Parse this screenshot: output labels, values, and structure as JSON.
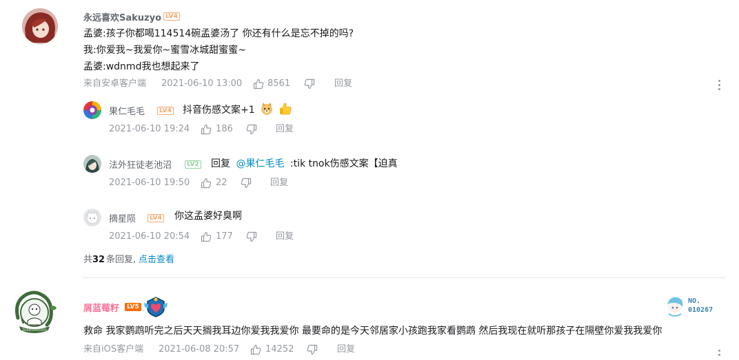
{
  "c1": {
    "username": "永远喜欢Sakuzyo",
    "level": "LV4",
    "lines": [
      "孟婆:孩子你都喝114514碗孟婆汤了 你还有什么是忘不掉的吗?",
      "我:你爱我~我爱你~蜜雪冰城甜蜜蜜~",
      "孟婆:wdnmd我也想起来了"
    ],
    "source": "来自安卓客户端",
    "time": "2021-06-10 13:00",
    "likes": "8561",
    "reply_label": "回复"
  },
  "replies": [
    {
      "username": "果仁毛毛",
      "level": "LV4",
      "text": "抖音伤感文案+1",
      "time": "2021-06-10 19:24",
      "likes": "186",
      "reply_label": "回复"
    },
    {
      "username": "法外狂徒老池沼",
      "level": "LV2",
      "prefix": "回复",
      "mention": "@果仁毛毛",
      "text": ":tik tnok伤感文案【迫真",
      "time": "2021-06-10 19:50",
      "likes": "22",
      "reply_label": "回复"
    },
    {
      "username": "摘星陨",
      "level": "LV4",
      "text": "你这孟婆好臭啊",
      "time": "2021-06-10 20:54",
      "likes": "177",
      "reply_label": "回复"
    }
  ],
  "reply_summary": {
    "prefix": "共",
    "count": "32",
    "suffix": "条回复,",
    "link": "点击查看"
  },
  "c2": {
    "username": "屑蓝莓籽",
    "level": "LV5",
    "fan_badge": "NO.\n010267",
    "avatar_text": "ZHENTAPOTATO",
    "text": "救命 我家鹦鹉听完之后天天搁我耳边你爱我我爱你 最要命的是今天邻居家小孩跑我家看鹦鹉 然后我现在就听那孩子在隔壁你爱我我爱你",
    "source": "来自iOS客户端",
    "time": "2021-06-08 20:57",
    "likes": "14252",
    "reply_label": "回复"
  },
  "colors": {
    "vip_name": "#fb7299",
    "link": "#008ac5",
    "meta": "#9499a0"
  }
}
